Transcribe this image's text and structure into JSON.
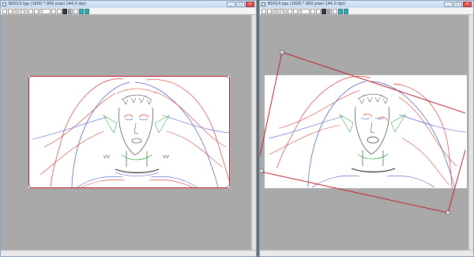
{
  "windows": [
    {
      "id": "left",
      "title": "B0013.tga (1600 * 900 pixel 144.0 dpi)",
      "zoom": "50.0 %",
      "frame_input": "0"
    },
    {
      "id": "right",
      "title": "B0014.tga (1600 * 900 pixel 144.0 dpi)",
      "zoom": "50.0 %",
      "frame_input": "0"
    }
  ],
  "window_buttons": {
    "minimize": "_",
    "maximize": "□",
    "close": "×"
  },
  "colors": {
    "canvas_bg": "#a9a9a9",
    "paper": "#ffffff",
    "line_red": "#d63a3a",
    "line_blue": "#4b55c9",
    "line_green": "#3fae4f",
    "line_black": "#2a2a2a",
    "selection": "#c0202a"
  },
  "icons": [
    "app-icon",
    "new-icon",
    "open-icon",
    "zoom-icon",
    "flip-icon",
    "grid-icon",
    "onion-skin-icon",
    "light-table-icon"
  ]
}
